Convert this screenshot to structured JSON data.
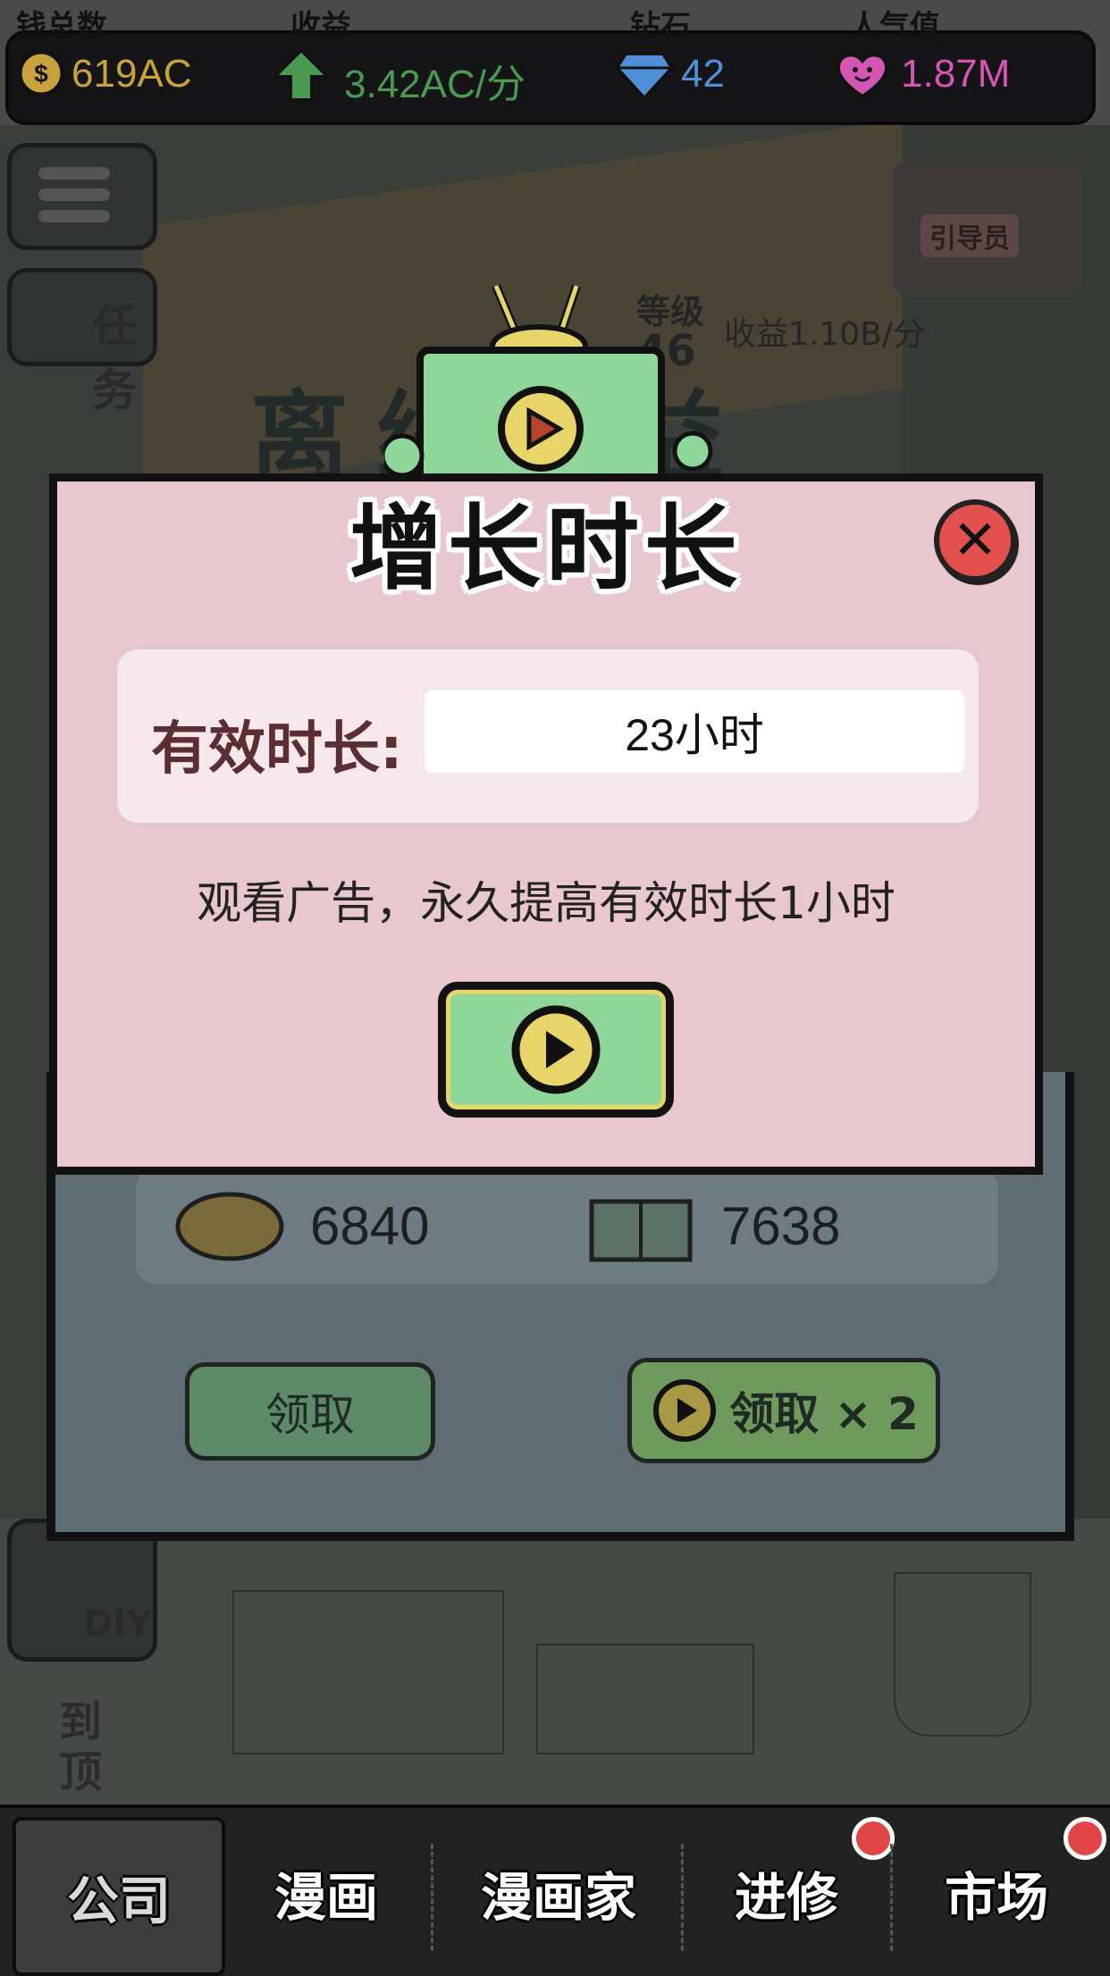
{
  "topbar": {
    "stats": [
      {
        "title": "钱总数",
        "value": "619AC",
        "color": "#c9a23c",
        "icon": "coin-icon"
      },
      {
        "title": "收益",
        "value": "3.42AC/分",
        "color": "#4a9a52",
        "icon": "up-arrow-icon"
      },
      {
        "title": "钻石",
        "value": "42",
        "color": "#4e8fd8",
        "icon": "diamond-icon"
      },
      {
        "title": "人气值",
        "value": "1.87M",
        "color": "#d455b4",
        "icon": "heart-icon"
      }
    ]
  },
  "background": {
    "side_menu_task": "任务",
    "guide_label": "引导员",
    "level_label": "等级",
    "level_value": "46",
    "income_label": "收益1.10B/分",
    "offline_title": "离线收益",
    "reward_1_value": "6840",
    "reward_2_value": "7638",
    "claim_label": "领取",
    "claim_double_label": "领取 × 2",
    "diy_label": "DIY",
    "to_top_label": "到顶"
  },
  "modal": {
    "title": "增长时长",
    "field_label": "有效时长:",
    "field_value": "23小时",
    "description": "观看广告，永久提高有效时长1小时"
  },
  "tabs": [
    {
      "label": "公司",
      "active": true,
      "badge": false
    },
    {
      "label": "漫画",
      "active": false,
      "badge": false
    },
    {
      "label": "漫画家",
      "active": false,
      "badge": false
    },
    {
      "label": "进修",
      "active": false,
      "badge": true
    },
    {
      "label": "市场",
      "active": false,
      "badge": true
    }
  ],
  "colors": {
    "modal_bg": "#e8c7cf",
    "accent_green": "#8ed69a",
    "close_red": "#e2514e",
    "badge_red": "#e04646"
  }
}
